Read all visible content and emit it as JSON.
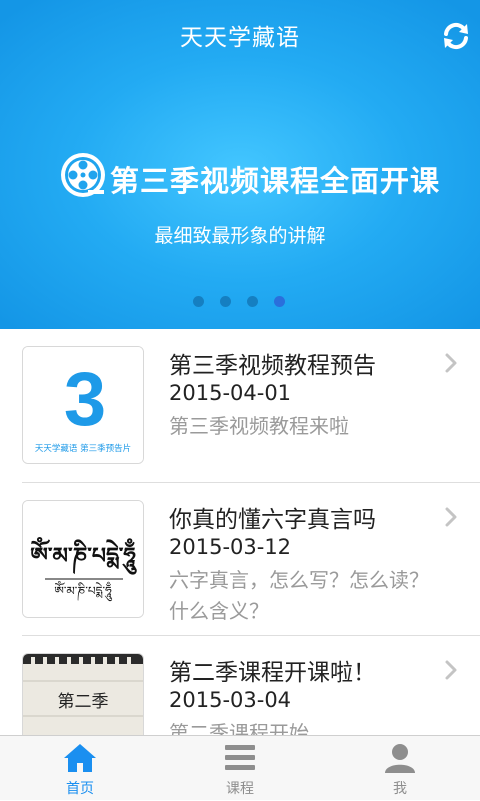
{
  "header": {
    "title": "天天学藏语",
    "refresh_icon": "refresh-icon"
  },
  "banner": {
    "headline": "第三季视频课程全面开课",
    "subhead": "最细致最形象的讲解",
    "film_icon": "film-reel-icon",
    "slides_total": 4,
    "active_slide": 4,
    "accent": "#23abf3"
  },
  "list": {
    "items": [
      {
        "title": "第三季视频教程预告",
        "date": "2015-04-01",
        "desc": "第三季视频教程来啦",
        "thumb": {
          "numeral": "3",
          "caption": "天天学藏语 第三季预告片"
        }
      },
      {
        "title": "你真的懂六字真言吗",
        "date": "2015-03-12",
        "desc": "六字真言，怎么写？怎么读？什么含义？",
        "thumb": {
          "script": "ཨོཾ་མ་ཎི་པདྨེ་ཧཱུྃ",
          "script_small": "ཨོཾ་མ་ཎི་པདྨེ་ཧཱུྃ"
        }
      },
      {
        "title": "第二季课程开课啦！",
        "date": "2015-03-04",
        "desc": "第二季课程开始",
        "thumb": {
          "caption": "第二季"
        }
      }
    ]
  },
  "tabbar": {
    "tabs": [
      {
        "label": "首页",
        "icon": "home-icon",
        "active": true
      },
      {
        "label": "课程",
        "icon": "list-icon",
        "active": false
      },
      {
        "label": "我",
        "icon": "user-icon",
        "active": false
      }
    ],
    "active_color": "#1a8ff0",
    "inactive_color": "#8e8e8e"
  }
}
